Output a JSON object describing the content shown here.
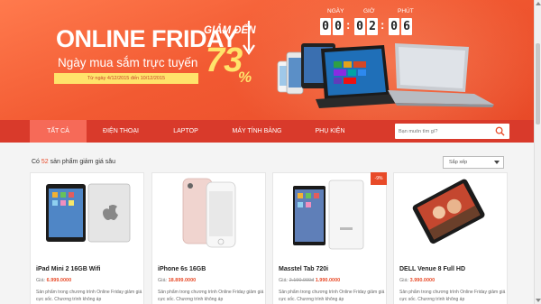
{
  "banner": {
    "title": "ONLINE FRIDAY",
    "subtitle": "Ngày mua sắm trực tuyến",
    "date_range": "Từ ngày 4/12/2015 đến 10/12/2015",
    "discount_label": "GIẢM ĐẾN",
    "discount_value": "73",
    "discount_unit": "%",
    "brand_color": "#f25a32",
    "highlight_color": "#ffe36b"
  },
  "countdown": {
    "labels": [
      "NGÀY",
      "GIỜ",
      "PHÚT"
    ],
    "days": [
      "0",
      "0"
    ],
    "hours": [
      "0",
      "2"
    ],
    "minutes": [
      "0",
      "6"
    ]
  },
  "nav": {
    "items": [
      "TẤT CẢ",
      "ĐIỆN THOẠI",
      "LAPTOP",
      "MÁY TÍNH BẢNG",
      "PHỤ KIỆN"
    ],
    "active_index": 0,
    "search_placeholder": "Bạn muốn tìm gì?",
    "search_icon": "search-icon"
  },
  "main": {
    "count_prefix": "Có",
    "count_value": "52",
    "count_suffix": "sản phẩm giảm giá sâu",
    "sort_label": "Sắp xếp"
  },
  "products": [
    {
      "name": "iPad Mini 2 16GB Wifi",
      "price_label": "Giá:",
      "old_price": "",
      "price": "6.999.0000",
      "description": "Sản phẩm trong chương trình Online Friday giảm giá cực sốc. Chương trình không áp",
      "badge": ""
    },
    {
      "name": "iPhone 6s 16GB",
      "price_label": "Giá:",
      "old_price": "",
      "price": "18.899.0000",
      "description": "Sản phẩm trong chương trình Online Friday giảm giá cực sốc. Chương trình không áp",
      "badge": ""
    },
    {
      "name": "Masstel Tab 720i",
      "price_label": "Giá:",
      "old_price": "2.190.000đ",
      "price": "1.990.0000",
      "description": "Sản phẩm trong chương trình Online Friday giảm giá cực sốc. Chương trình không áp",
      "badge": "-9%"
    },
    {
      "name": "DELL Venue 8 Full HD",
      "price_label": "Giá:",
      "old_price": "",
      "price": "3.990.0000",
      "description": "Sản phẩm trong chương trình Online Friday giảm giá cực sốc. Chương trình không áp",
      "badge": ""
    }
  ]
}
